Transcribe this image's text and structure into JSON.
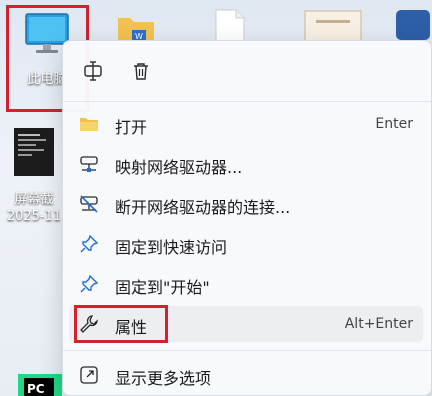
{
  "desktop": {
    "this_pc_label": "此电脑",
    "screenshot_label_line1": "屏幕截",
    "screenshot_label_line2": "2025-11"
  },
  "context_menu": {
    "items": [
      {
        "label": "打开",
        "shortcut": "Enter",
        "icon": "folder-icon"
      },
      {
        "label": "映射网络驱动器...",
        "shortcut": "",
        "icon": "map-drive-icon"
      },
      {
        "label": "断开网络驱动器的连接...",
        "shortcut": "",
        "icon": "disconnect-drive-icon"
      },
      {
        "label": "固定到快速访问",
        "shortcut": "",
        "icon": "pin-icon"
      },
      {
        "label": "固定到\"开始\"",
        "shortcut": "",
        "icon": "pin-icon"
      },
      {
        "label": "属性",
        "shortcut": "Alt+Enter",
        "icon": "wrench-icon"
      },
      {
        "label": "显示更多选项",
        "shortcut": "",
        "icon": "more-options-icon"
      }
    ],
    "quick_actions": [
      "rename-icon",
      "delete-icon"
    ]
  },
  "colors": {
    "highlight": "#d4202b",
    "accent": "#1f6fd1"
  }
}
